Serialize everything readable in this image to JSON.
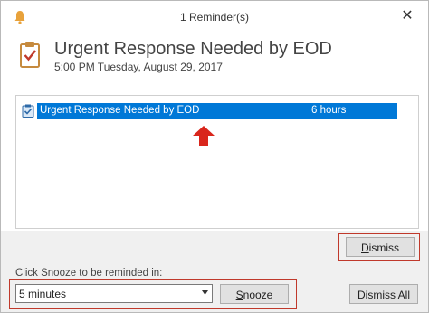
{
  "window": {
    "title": "1 Reminder(s)",
    "close_glyph": "✕"
  },
  "reminder": {
    "subject": "Urgent Response Needed by EOD",
    "datetime": "5:00 PM Tuesday, August 29, 2017"
  },
  "list": {
    "items": [
      {
        "subject": "Urgent Response Needed by EOD",
        "due_in": "6 hours",
        "selected": true
      }
    ]
  },
  "actions": {
    "dismiss_label": "Dismiss",
    "dismiss_all_label": "Dismiss All",
    "snooze_label": "Snooze",
    "snooze_prompt": "Click Snooze to be reminded in:",
    "snooze_value": "5 minutes"
  },
  "icons": {
    "title": "bell-icon",
    "header": "clipboard-check-icon",
    "row": "clipboard-check-small-icon",
    "annotation": "red-arrow-up-icon"
  },
  "colors": {
    "selection": "#0078d7",
    "annotation_red": "#d9261c",
    "bell": "#e8a23b",
    "clipboard": "#c68a3e"
  }
}
